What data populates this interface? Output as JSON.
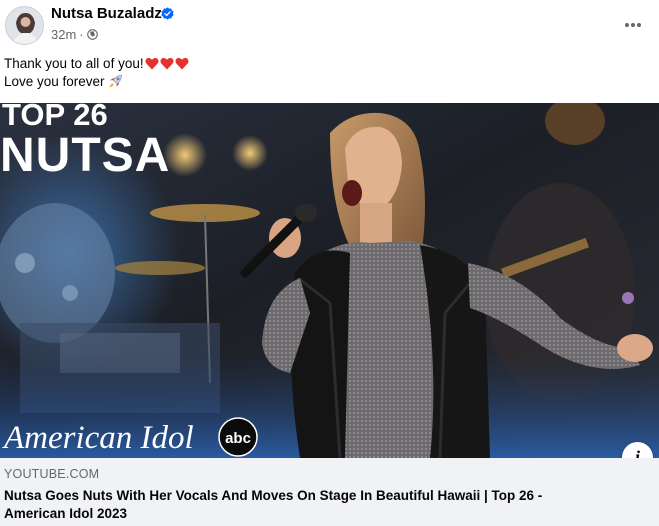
{
  "post": {
    "author_name": "Nutsa Buzaladze",
    "timestamp": "32m",
    "separator": "·",
    "caption_line1": "Thank you to all of you!",
    "caption_line2": "Love you forever"
  },
  "media": {
    "overlay_line1": "TOP 26",
    "overlay_line2": "NUTSA",
    "show_logo": "American Idol",
    "network_logo": "abc"
  },
  "link_preview": {
    "domain": "YOUTUBE.COM",
    "title": "Nutsa Goes Nuts With Her Vocals And Moves On Stage In Beautiful Hawaii | Top 26 - American Idol 2023"
  },
  "icons": {
    "verified": "verified-badge-icon",
    "privacy": "globe-icon",
    "more": "more-options-icon",
    "info": "info-icon",
    "hearts": "red-heart-icon",
    "rocket": "rocket-icon"
  },
  "colors": {
    "verified_blue": "#0866ff",
    "secondary_text": "#65676b",
    "footer_bg": "#f0f2f5",
    "heart_red": "#e8312f"
  }
}
